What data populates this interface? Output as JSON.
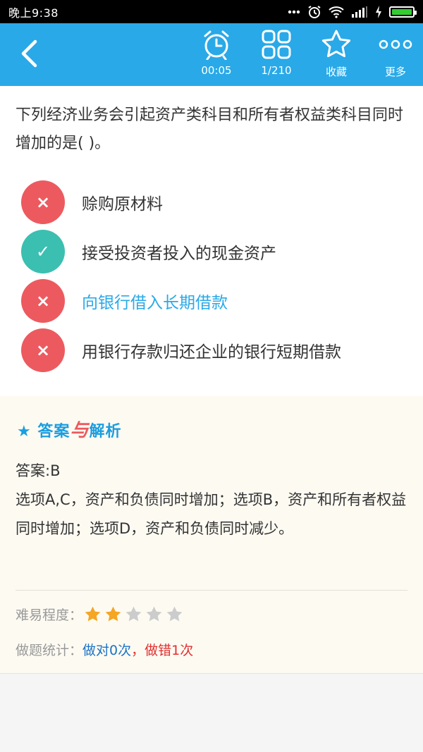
{
  "status_bar": {
    "time": "晚上9:38",
    "icons": [
      "dots-icon",
      "alarm-icon",
      "wifi-icon",
      "signal-icon",
      "charging-icon",
      "battery-icon"
    ]
  },
  "toolbar": {
    "back_icon": "back-arrow-icon",
    "timer": {
      "icon": "alarm-clock-icon",
      "label": "00:05"
    },
    "progress": {
      "icon": "grid-icon",
      "label": "1/210"
    },
    "favorite": {
      "icon": "star-outline-icon",
      "label": "收藏"
    },
    "more": {
      "icon": "more-dots-icon",
      "label": "更多"
    },
    "color": "#29a9e8"
  },
  "question": {
    "text": "下列经济业务会引起资产类科目和所有者权益类科目同时增加的是( )。",
    "options": [
      {
        "status": "wrong",
        "mark": "×",
        "text": "赊购原材料"
      },
      {
        "status": "correct",
        "mark": "✓",
        "text": "接受投资者投入的现金资产"
      },
      {
        "status": "wrong",
        "mark": "×",
        "text": "向银行借入长期借款",
        "selected": true
      },
      {
        "status": "wrong",
        "mark": "×",
        "text": "用银行存款归还企业的银行短期借款"
      }
    ]
  },
  "analysis": {
    "title_star": "★",
    "title_a": "答案",
    "title_yu": "与",
    "title_b": "解析",
    "answer": "答案:B",
    "explanation": "选项A,C，资产和负债同时增加；选项B，资产和所有者权益同时增加；选项D，资产和负债同时减少。",
    "difficulty_label": "难易程度：",
    "difficulty_rating": 2,
    "difficulty_max": 5,
    "stats_label": "做题统计：",
    "stats_correct": "做对0次",
    "stats_sep": "，",
    "stats_wrong": "做错1次"
  },
  "colors": {
    "wrong": "#ec5a5f",
    "correct": "#3bbfb1",
    "star_on": "#f5a623",
    "star_off": "#cccccc"
  }
}
